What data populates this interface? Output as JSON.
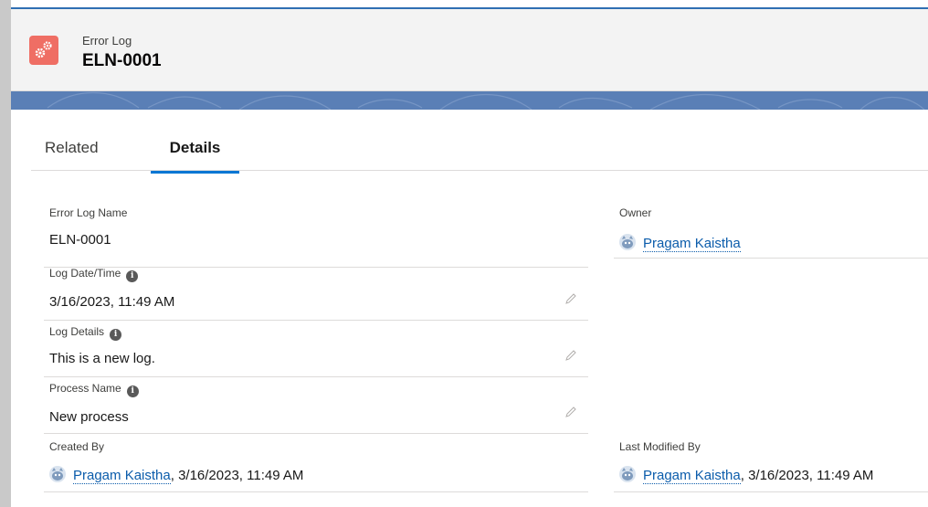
{
  "header": {
    "object_label": "Error Log",
    "record_title": "ELN-0001",
    "icon": "gears-icon",
    "icon_color": "#ef6e64"
  },
  "tabs": [
    {
      "label": "Related",
      "active": false
    },
    {
      "label": "Details",
      "active": true
    }
  ],
  "fields": {
    "error_log_name": {
      "label": "Error Log Name",
      "value": "ELN-0001"
    },
    "owner": {
      "label": "Owner",
      "value": "Pragam Kaistha"
    },
    "log_datetime": {
      "label": "Log Date/Time",
      "value": "3/16/2023, 11:49 AM"
    },
    "log_details": {
      "label": "Log Details",
      "value": "This is a new log."
    },
    "process_name": {
      "label": "Process Name",
      "value": "New process"
    },
    "created_by": {
      "label": "Created By",
      "user": "Pragam Kaistha",
      "date": ", 3/16/2023, 11:49 AM"
    },
    "last_modified_by": {
      "label": "Last Modified By",
      "user": "Pragam Kaistha",
      "date": ", 3/16/2023, 11:49 AM"
    }
  },
  "colors": {
    "accent": "#0176d3",
    "link": "#0b5cab",
    "band": "#5a7fb6"
  }
}
